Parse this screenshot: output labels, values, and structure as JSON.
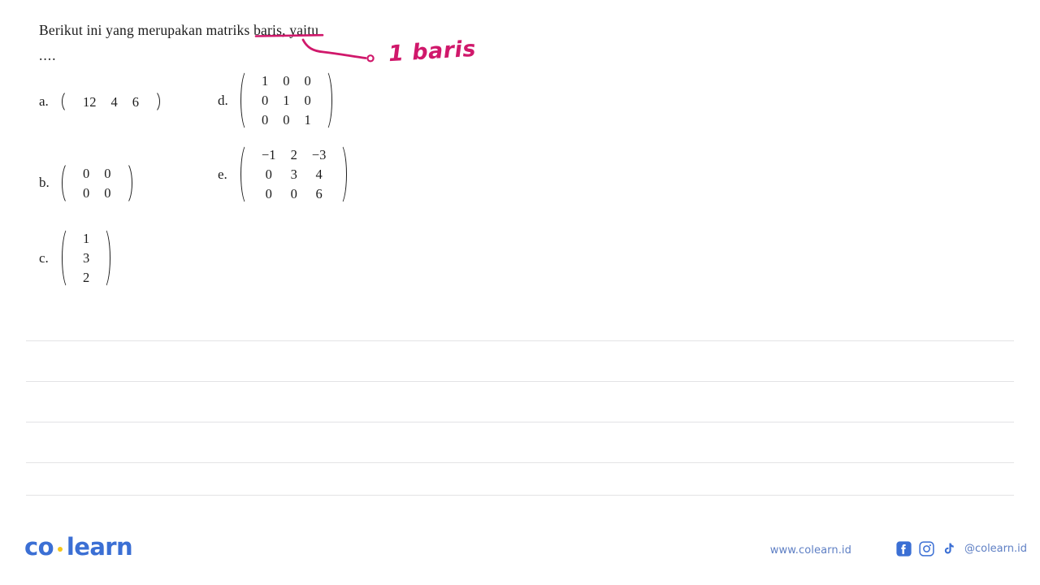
{
  "question": {
    "prompt": "Berikut ini yang merupakan matriks baris, yaitu",
    "continuation": "...."
  },
  "options": [
    {
      "label": "a.",
      "name": "option-a",
      "rows": 1,
      "cols": 3,
      "cells": [
        "12",
        "4",
        "6"
      ]
    },
    {
      "label": "b.",
      "name": "option-b",
      "rows": 2,
      "cols": 2,
      "cells": [
        "0",
        "0",
        "0",
        "0"
      ]
    },
    {
      "label": "c.",
      "name": "option-c",
      "rows": 3,
      "cols": 1,
      "cells": [
        "1",
        "3",
        "2"
      ]
    },
    {
      "label": "d.",
      "name": "option-d",
      "rows": 3,
      "cols": 3,
      "cells": [
        "1",
        "0",
        "0",
        "0",
        "1",
        "0",
        "0",
        "0",
        "1"
      ]
    },
    {
      "label": "e.",
      "name": "option-e",
      "rows": 3,
      "cols": 3,
      "cells": [
        "−1",
        "2",
        "−3",
        "0",
        "3",
        "4",
        "0",
        "0",
        "6"
      ]
    }
  ],
  "annotation": {
    "text": "1 baris",
    "color": "#d0186b",
    "underline_target": "matriks baris",
    "arrow": "curved-arrow-with-loop-head"
  },
  "ruled_lines": {
    "count": 5,
    "color": "#e3e3e5"
  },
  "footer": {
    "logo_first": "co",
    "logo_second": "learn",
    "logo_color": "#3b6fd4",
    "dot_color": "#f5c518",
    "website": "www.colearn.id",
    "handle": "@colearn.id",
    "socials": [
      "facebook-icon",
      "instagram-icon",
      "tiktok-icon"
    ]
  }
}
